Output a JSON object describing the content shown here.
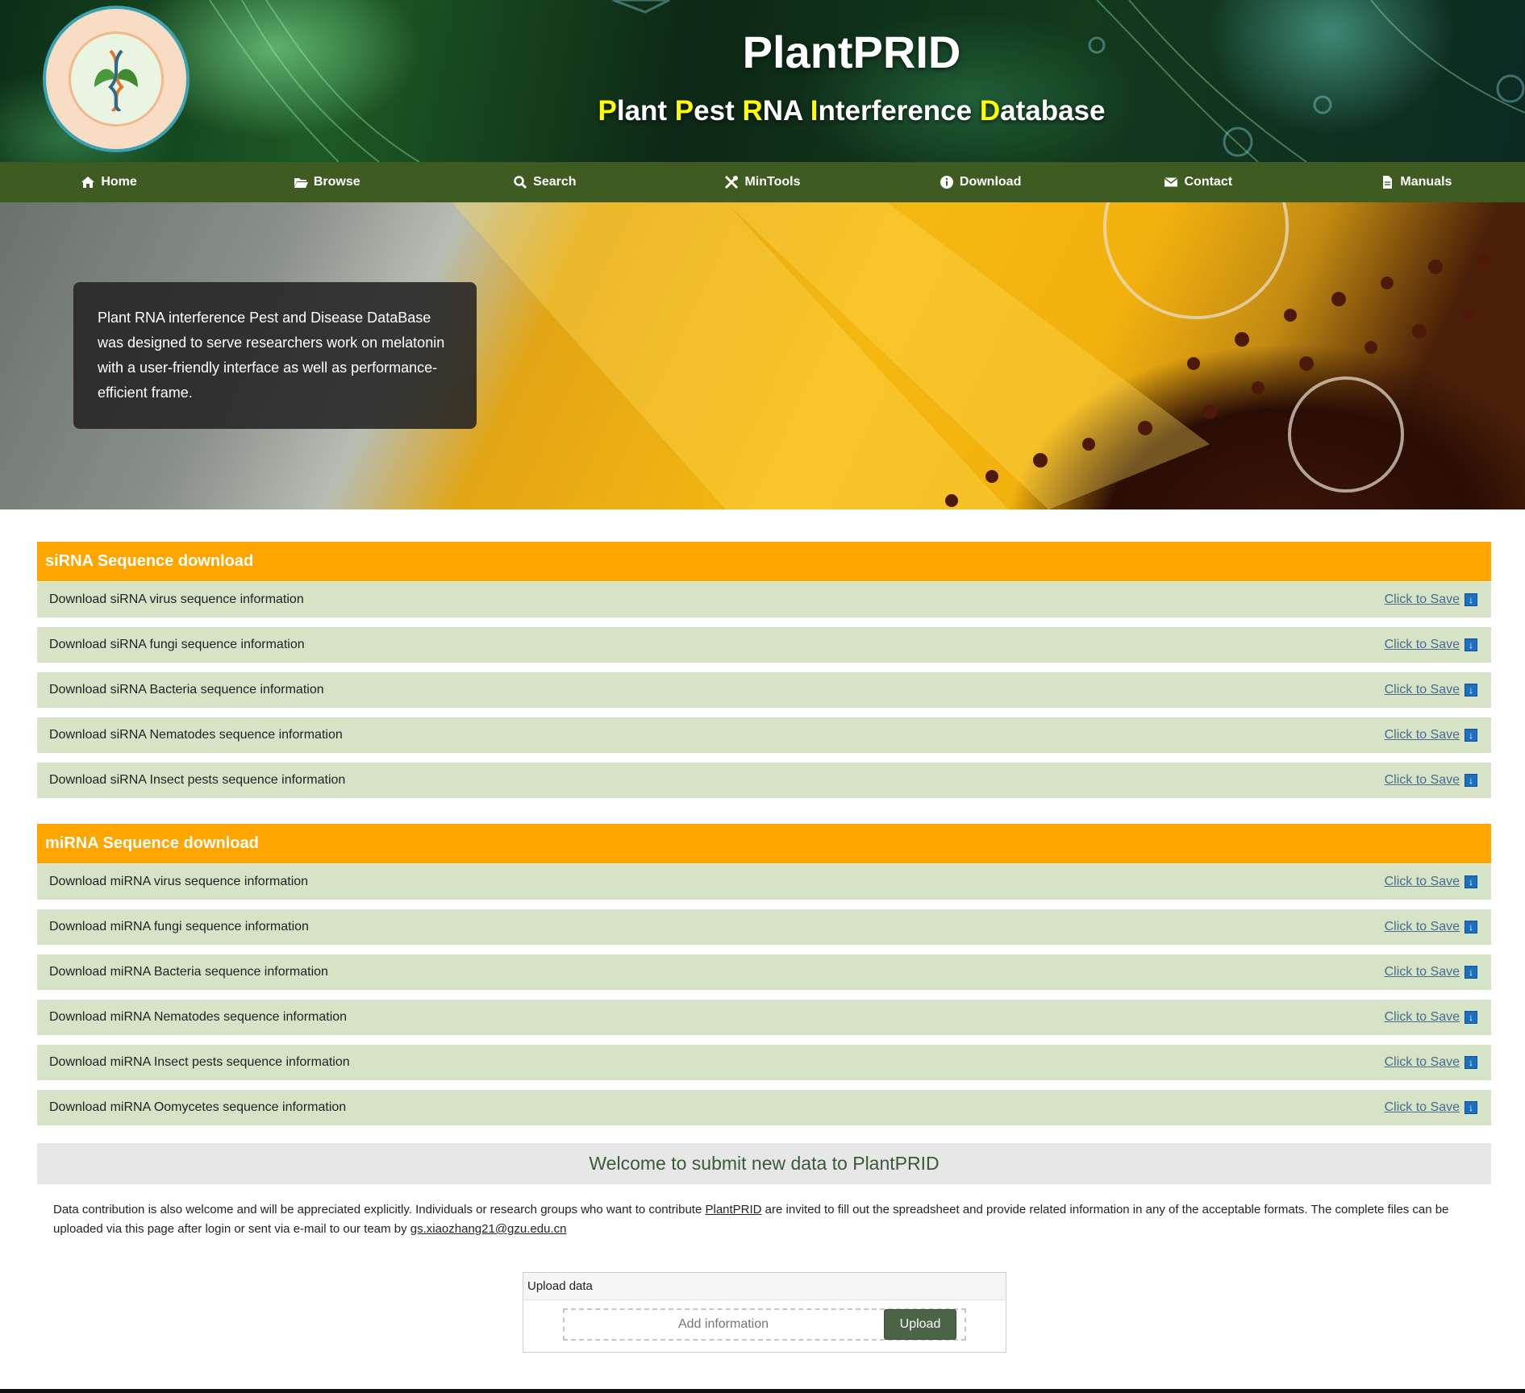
{
  "header": {
    "title": "PlantPRID",
    "subtitle_parts": [
      {
        "text": "P",
        "hl": true
      },
      {
        "text": "lant ",
        "hl": false
      },
      {
        "text": "P",
        "hl": true
      },
      {
        "text": "est ",
        "hl": false
      },
      {
        "text": "R",
        "hl": true
      },
      {
        "text": "NA ",
        "hl": false
      },
      {
        "text": "I",
        "hl": true
      },
      {
        "text": "nterference ",
        "hl": false
      },
      {
        "text": "D",
        "hl": true
      },
      {
        "text": "atabase",
        "hl": false
      }
    ],
    "logo_icon": "dna-leaf-logo-icon"
  },
  "nav": {
    "items": [
      {
        "label": "Home",
        "icon": "home-icon"
      },
      {
        "label": "Browse",
        "icon": "folder-open-icon"
      },
      {
        "label": "Search",
        "icon": "search-icon"
      },
      {
        "label": "MinTools",
        "icon": "tools-icon"
      },
      {
        "label": "Download",
        "icon": "info-circle-icon"
      },
      {
        "label": "Contact",
        "icon": "envelope-icon"
      },
      {
        "label": "Manuals",
        "icon": "document-icon"
      }
    ]
  },
  "hero": {
    "text": "Plant RNA interference Pest and Disease DataBase was designed to serve researchers work on melatonin with a user-friendly interface as well as performance-efficient frame."
  },
  "sirna": {
    "title": "siRNA Sequence download",
    "rows": [
      {
        "label": "Download siRNA virus sequence information",
        "link": "Click to Save"
      },
      {
        "label": "Download siRNA fungi sequence information",
        "link": "Click to Save"
      },
      {
        "label": "Download siRNA Bacteria sequence information",
        "link": "Click to Save"
      },
      {
        "label": "Download siRNA Nematodes sequence information",
        "link": "Click to Save"
      },
      {
        "label": "Download siRNA Insect pests sequence information",
        "link": "Click to Save"
      }
    ]
  },
  "mirna": {
    "title": "miRNA Sequence download",
    "rows": [
      {
        "label": "Download miRNA virus sequence information",
        "link": "Click to Save"
      },
      {
        "label": "Download miRNA fungi sequence information",
        "link": "Click to Save"
      },
      {
        "label": "Download miRNA Bacteria sequence information",
        "link": "Click to Save"
      },
      {
        "label": "Download miRNA Nematodes sequence information",
        "link": "Click to Save"
      },
      {
        "label": "Download miRNA Insect pests sequence information",
        "link": "Click to Save"
      },
      {
        "label": "Download miRNA Oomycetes sequence information",
        "link": "Click to Save"
      }
    ]
  },
  "submit": {
    "title": "Welcome to submit new data to PlantPRID",
    "text_before": "Data contribution is also welcome and will be appreciated explicitly. Individuals or research groups who want to contribute ",
    "link_text": "PlantPRID",
    "text_after": " are invited to fill out the spreadsheet and provide related information in any of the acceptable formats. The complete files can be uploaded via this page after login or sent via e-mail to our team by ",
    "email": "gs.xiaozhang21@gzu.edu.cn"
  },
  "upload": {
    "panel_title": "Upload data",
    "placeholder": "Add information",
    "button": "Upload"
  },
  "colors": {
    "nav_bg": "#3e5c22",
    "section_header": "#ffa500",
    "row_bg": "#d6e3c6",
    "subtitle_highlight": "#ffff00",
    "upload_button": "#4a6445"
  }
}
